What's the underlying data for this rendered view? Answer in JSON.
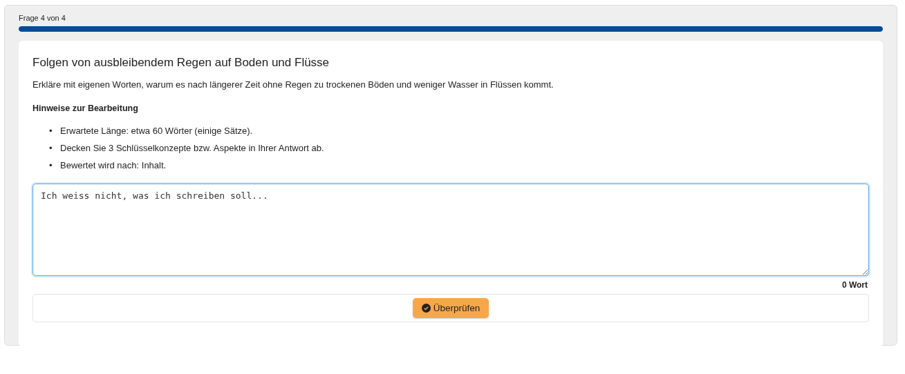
{
  "progress": {
    "label": "Frage 4 von 4",
    "level": 1
  },
  "question": {
    "title": "Folgen von ausbleibendem Regen auf Boden und Flüsse",
    "prompt": "Erkläre mit eigenen Worten, warum es nach längerer Zeit ohne Regen zu trockenen Böden und weniger Wasser in Flüssen kommt.",
    "hints_heading": "Hinweise zur Bearbeitung",
    "hints": [
      {
        "marker": "•",
        "text": "Erwartete Länge: etwa 60 Wörter (einige Sätze)."
      },
      {
        "marker": "•",
        "text": "Decken Sie 3 Schlüsselkonzepte bzw. Aspekte in Ihrer Antwort ab."
      },
      {
        "marker": "•",
        "text": "Bewertet wird nach: Inhalt."
      }
    ]
  },
  "answer": {
    "value": "Ich weiss nicht, was ich schreiben soll...",
    "focused": true,
    "word_count": "0 Wort"
  },
  "buttons": [
    {
      "label": "Überprüfen",
      "kind": "check"
    }
  ]
}
